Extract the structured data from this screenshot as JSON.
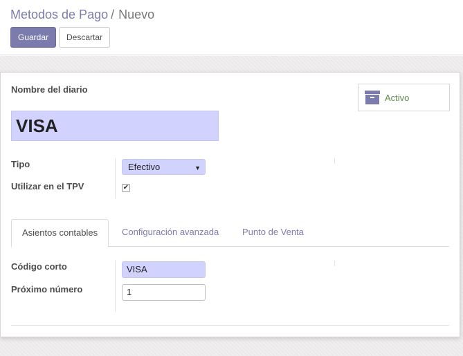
{
  "breadcrumb": {
    "parent": "Metodos de Pago",
    "separator": "/",
    "current": "Nuevo"
  },
  "toolbar": {
    "save_label": "Guardar",
    "discard_label": "Descartar"
  },
  "form": {
    "name_label": "Nombre del diario",
    "name_value": "VISA",
    "active_button_label": "Activo",
    "type_label": "Tipo",
    "type_value": "Efectivo",
    "type_arrow": "▼",
    "pos_label": "Utilizar en el TPV",
    "pos_checked": true,
    "pos_check_glyph": "✔"
  },
  "tabs": [
    {
      "label": "Asientos contables",
      "active": true
    },
    {
      "label": "Configuración avanzada",
      "active": false
    },
    {
      "label": "Punto de Venta",
      "active": false
    }
  ],
  "accounting": {
    "code_label": "Código corto",
    "code_value": "VISA",
    "next_number_label": "Próximo número",
    "next_number_value": "1"
  },
  "icons": {
    "active": "archive-icon"
  },
  "colors": {
    "accent": "#7c7bad",
    "required_field": "#d2d2ff",
    "active_text": "#5f8b4c"
  }
}
